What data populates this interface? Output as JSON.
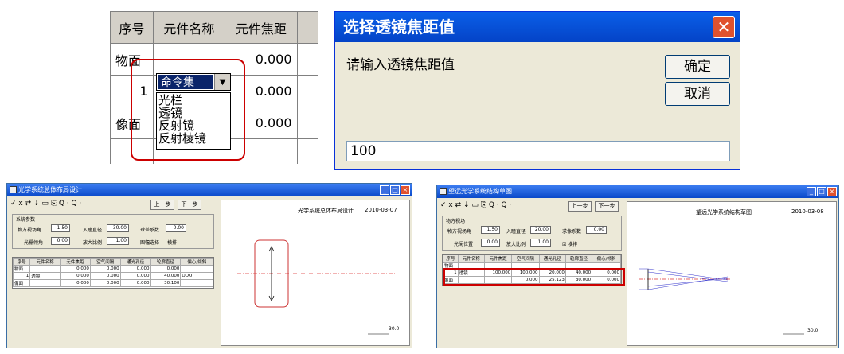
{
  "table_crop": {
    "headers": [
      "序号",
      "元件名称",
      "元件焦距"
    ],
    "rows": [
      {
        "seq": "物面",
        "name": "",
        "focal": "0.000"
      },
      {
        "seq": "1",
        "name": "命令集",
        "focal": "0.000"
      },
      {
        "seq": "像面",
        "name": "",
        "focal": "0.000"
      }
    ],
    "dropdown": [
      "光栏",
      "透镜",
      "反射镜",
      "反射棱镜"
    ]
  },
  "dialog": {
    "title": "选择透镜焦距值",
    "close": "✕",
    "prompt": "请输入透镜焦距值",
    "ok": "确定",
    "cancel": "取消",
    "value": "100"
  },
  "win1": {
    "title": "光学系统总体布局设计",
    "toolbar": "✓ ⅹ ⇄ ⇣ ▭ ⎘ Q · Q ·",
    "prev": "上一步",
    "next": "下一步",
    "group": "系统参数",
    "obj_field_label": "物方视场角",
    "obj_field": "1.50",
    "entr_label": "入瞳直径",
    "entr": "30.00",
    "coef_label": "球差系数",
    "coef": "0.00",
    "aper_label": "光栅倾角",
    "aper": "0.00",
    "mag_label": "放大比例",
    "mag": "1.00",
    "ctrl_label": "图幅选择",
    "ctrl_val": "横排",
    "headers": [
      "序号",
      "元件名称",
      "元件焦距",
      "空气间隔",
      "通光孔径",
      "轮廓直径",
      "偏心/倾斜"
    ],
    "rows": [
      [
        "物面",
        "",
        "0.000",
        "0.000",
        "0.000",
        "0.000",
        ""
      ],
      [
        "1",
        "透镜",
        "0.000",
        "0.000",
        "0.000",
        "40.000",
        "OOO"
      ],
      [
        "像面",
        "",
        "0.000",
        "0.000",
        "0.000",
        "30.100",
        ""
      ]
    ],
    "canvas_title": "光学系统总体布局设计",
    "canvas_date": "2010-03-07",
    "scale": "30.0"
  },
  "win2": {
    "title": "望远光学系统结构草图",
    "toolbar": "✓ ⅹ ⇄ ⇣ ▭ ⎘ Q · Q ·",
    "prev": "上一步",
    "next": "下一步",
    "group": "物方视场",
    "obj_field_label": "物方视场角",
    "obj_field": "1.50",
    "entr_label": "入瞳直径",
    "entr": "20.00",
    "coef_label": "求像系数",
    "coef": "0.00",
    "aper_label": "光阑位置",
    "aper": "0.00",
    "mag_label": "放大比例",
    "mag": "1.00",
    "check": "横排",
    "headers": [
      "序号",
      "元件名称",
      "元件焦距",
      "空气间隔",
      "通光孔径",
      "轮廓直径",
      "偏心/倾斜"
    ],
    "rows": [
      [
        "物面",
        "",
        "",
        "",
        "",
        "",
        ""
      ],
      [
        "1",
        "透镜",
        "100.000",
        "100.000",
        "20.000",
        "40.000",
        "0.000"
      ],
      [
        "像面",
        "",
        "",
        "0.000",
        "25.123",
        "30.000",
        "0.000"
      ]
    ],
    "canvas_title": "望远光学系统结构草图",
    "canvas_date": "2010-03-08",
    "scale": "30.0"
  }
}
